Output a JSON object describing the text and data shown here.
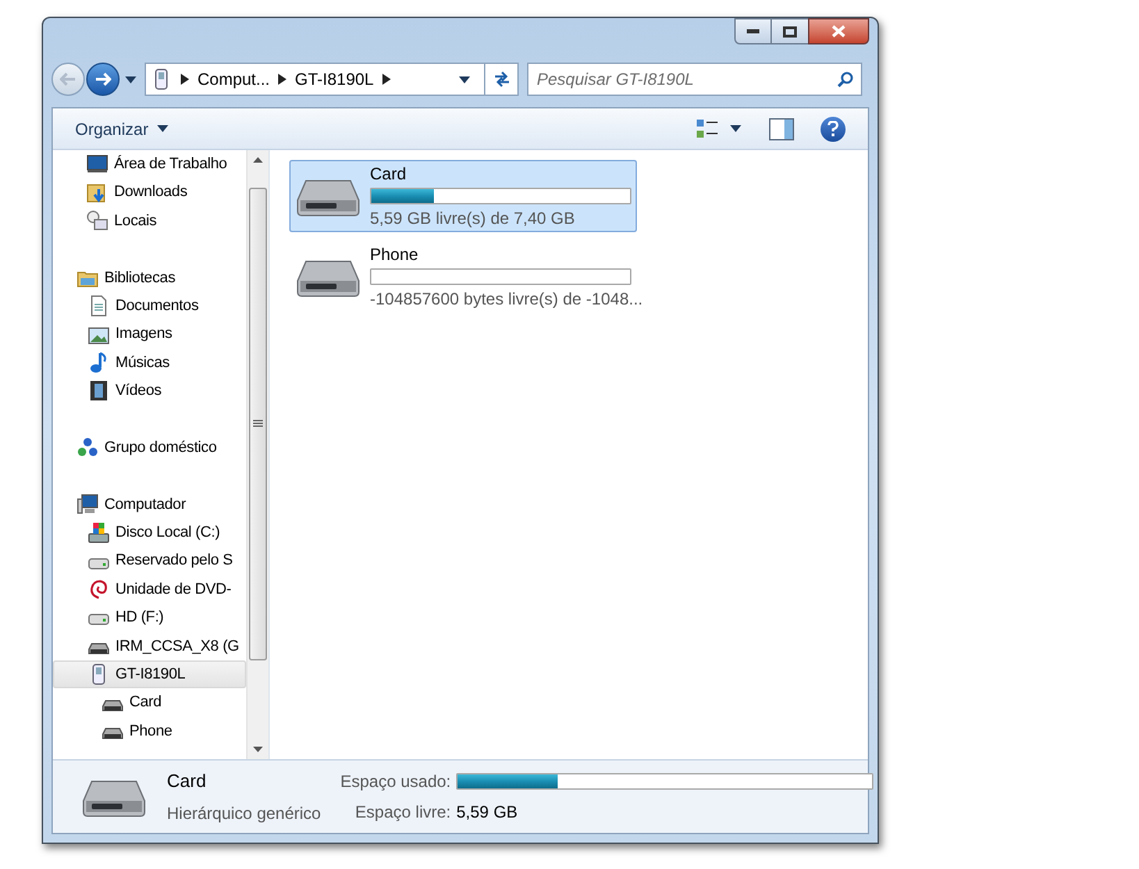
{
  "address_bar": {
    "crumbs": [
      "Comput...",
      "GT-I8190L"
    ]
  },
  "search": {
    "placeholder": "Pesquisar GT-I8190L"
  },
  "toolbar": {
    "organize": "Organizar"
  },
  "nav_pane": {
    "favorites": [
      {
        "label": "Área de Trabalho",
        "kind": "desktop"
      },
      {
        "label": "Downloads",
        "kind": "download"
      },
      {
        "label": "Locais",
        "kind": "places"
      }
    ],
    "tree": [
      {
        "label": "Bibliotecas",
        "kind": "library",
        "selected": false,
        "children": [
          {
            "label": "Documentos",
            "kind": "document",
            "selected": false
          },
          {
            "label": "Imagens",
            "kind": "image",
            "selected": false
          },
          {
            "label": "Músicas",
            "kind": "music",
            "selected": false
          },
          {
            "label": "Vídeos",
            "kind": "video",
            "selected": false
          }
        ]
      },
      {
        "label": "Grupo doméstico",
        "kind": "homegroup",
        "selected": false
      },
      {
        "label": "Computador",
        "kind": "computer",
        "selected": false,
        "children": [
          {
            "label": "Disco Local (C:)",
            "kind": "windrive",
            "selected": false
          },
          {
            "label": "Reservado pelo S",
            "kind": "drive",
            "selected": false
          },
          {
            "label": "Unidade de DVD-",
            "kind": "dvd",
            "selected": false
          },
          {
            "label": "HD (F:)",
            "kind": "drive",
            "selected": false
          },
          {
            "label": "IRM_CCSA_X8 (G",
            "kind": "removable",
            "selected": false
          },
          {
            "label": "GT-I8190L",
            "kind": "phone",
            "selected": true,
            "children": [
              {
                "label": "Card",
                "kind": "removable",
                "selected": false
              },
              {
                "label": "Phone",
                "kind": "removable",
                "selected": false
              }
            ]
          }
        ]
      }
    ]
  },
  "drives": [
    {
      "name": "Card",
      "level": 0.24,
      "reading": "5,59 GB livre(s) de 7,40 GB",
      "selected": true
    },
    {
      "name": "Phone",
      "level": 0,
      "reading": "-104857600 bytes livre(s) de -1048...",
      "selected": false
    }
  ],
  "details": {
    "name": "Card",
    "type": "Hierárquico genérico",
    "used_label": "Espaço usado:",
    "level": 0.24,
    "free_label": "Espaço livre:",
    "free_value": "5,59 GB"
  }
}
